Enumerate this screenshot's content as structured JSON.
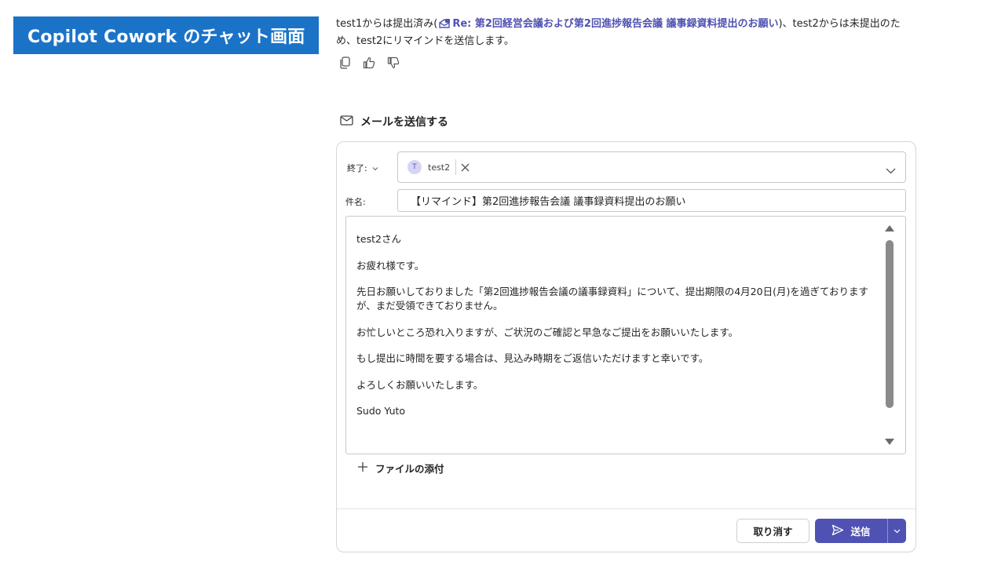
{
  "banner": {
    "title": "Copilot Cowork のチャット画面"
  },
  "message": {
    "text_before": "test1からは提出済み(",
    "link_text": "Re: 第2回経営会議および第2回進捗報告会議 議事録資料提出のお願い",
    "text_after": ")、test2からは未提出のため、test2にリマインドを送信します。"
  },
  "email": {
    "section_title": "メールを送信する",
    "to_label": "終了:",
    "recipient": {
      "initial": "T",
      "name": "test2"
    },
    "subject_label": "件名:",
    "subject": "【リマインド】第2回進捗報告会議 議事録資料提出のお願い",
    "body": [
      "test2さん",
      "お疲れ様です。",
      "先日お願いしておりました「第2回進捗報告会議の議事録資料」について、提出期限の4月20日(月)を過ぎておりますが、まだ受領できておりません。",
      "お忙しいところ恐れ入りますが、ご状況のご確認と早急なご提出をお願いいたします。",
      "もし提出に時間を要する場合は、見込み時期をご返信いただけますと幸いです。",
      "よろしくお願いいたします。",
      "Sudo Yuto"
    ],
    "attach_label": "ファイルの添付",
    "cancel_label": "取り消す",
    "send_label": "送信"
  },
  "colors": {
    "banner": "#1a73c7",
    "accent": "#4f52b2",
    "link": "#4f52b2"
  }
}
